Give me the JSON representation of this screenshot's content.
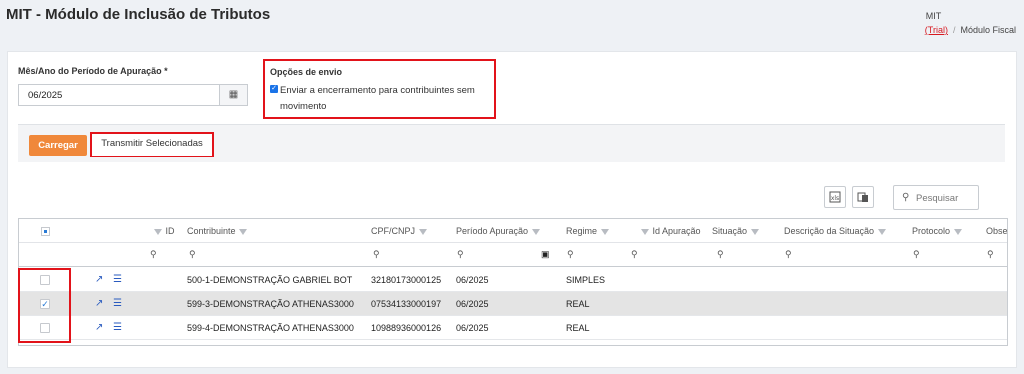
{
  "header": {
    "title": "MIT - Módulo de Inclusão de Tributos"
  },
  "breadcrumb": {
    "app": "MIT",
    "trial": "(Trial)",
    "separator": "/",
    "current": "Módulo Fiscal"
  },
  "form": {
    "period_label": "Mês/Ano do Período de Apuração *",
    "period_value": "06/2025",
    "options_label": "Opções de envio",
    "send_option": {
      "checked": true,
      "label": "Enviar a encerramento para contribuintes sem movimento"
    }
  },
  "toolbar": {
    "load_label": "Carregar",
    "transmit_label": "Transmitir Selecionadas"
  },
  "grid_tools": {
    "search_placeholder": "Pesquisar"
  },
  "table": {
    "columns": [
      "ID",
      "Contribuinte",
      "CPF/CNPJ",
      "Período Apuração",
      "Regime",
      "Id Apuração",
      "Situação",
      "Descrição da Situação",
      "Protocolo",
      "Obse"
    ],
    "rows": [
      {
        "checked": false,
        "selected": false,
        "id": "",
        "contribuinte": "500-1-DEMONSTRAÇÃO GABRIEL BOT",
        "cnpj": "32180173000125",
        "periodo": "06/2025",
        "regime": "SIMPLES"
      },
      {
        "checked": true,
        "selected": true,
        "id": "",
        "contribuinte": "599-3-DEMONSTRAÇÃO ATHENAS3000",
        "cnpj": "07534133000197",
        "periodo": "06/2025",
        "regime": "REAL"
      },
      {
        "checked": false,
        "selected": false,
        "id": "",
        "contribuinte": "599-4-DEMONSTRAÇÃO ATHENAS3000",
        "cnpj": "10988936000126",
        "periodo": "06/2025",
        "regime": "REAL"
      }
    ]
  },
  "colors": {
    "accent_orange": "#f0883a",
    "highlight_red": "#e2131a",
    "link_blue": "#2a5bbf"
  },
  "icons": {
    "calendar": "calendar-icon",
    "filter": "filter-icon",
    "search": "magnifier-icon",
    "export": "external-link-icon",
    "list": "list-icon",
    "excel": "excel-export-icon",
    "columns": "column-chooser-icon"
  }
}
